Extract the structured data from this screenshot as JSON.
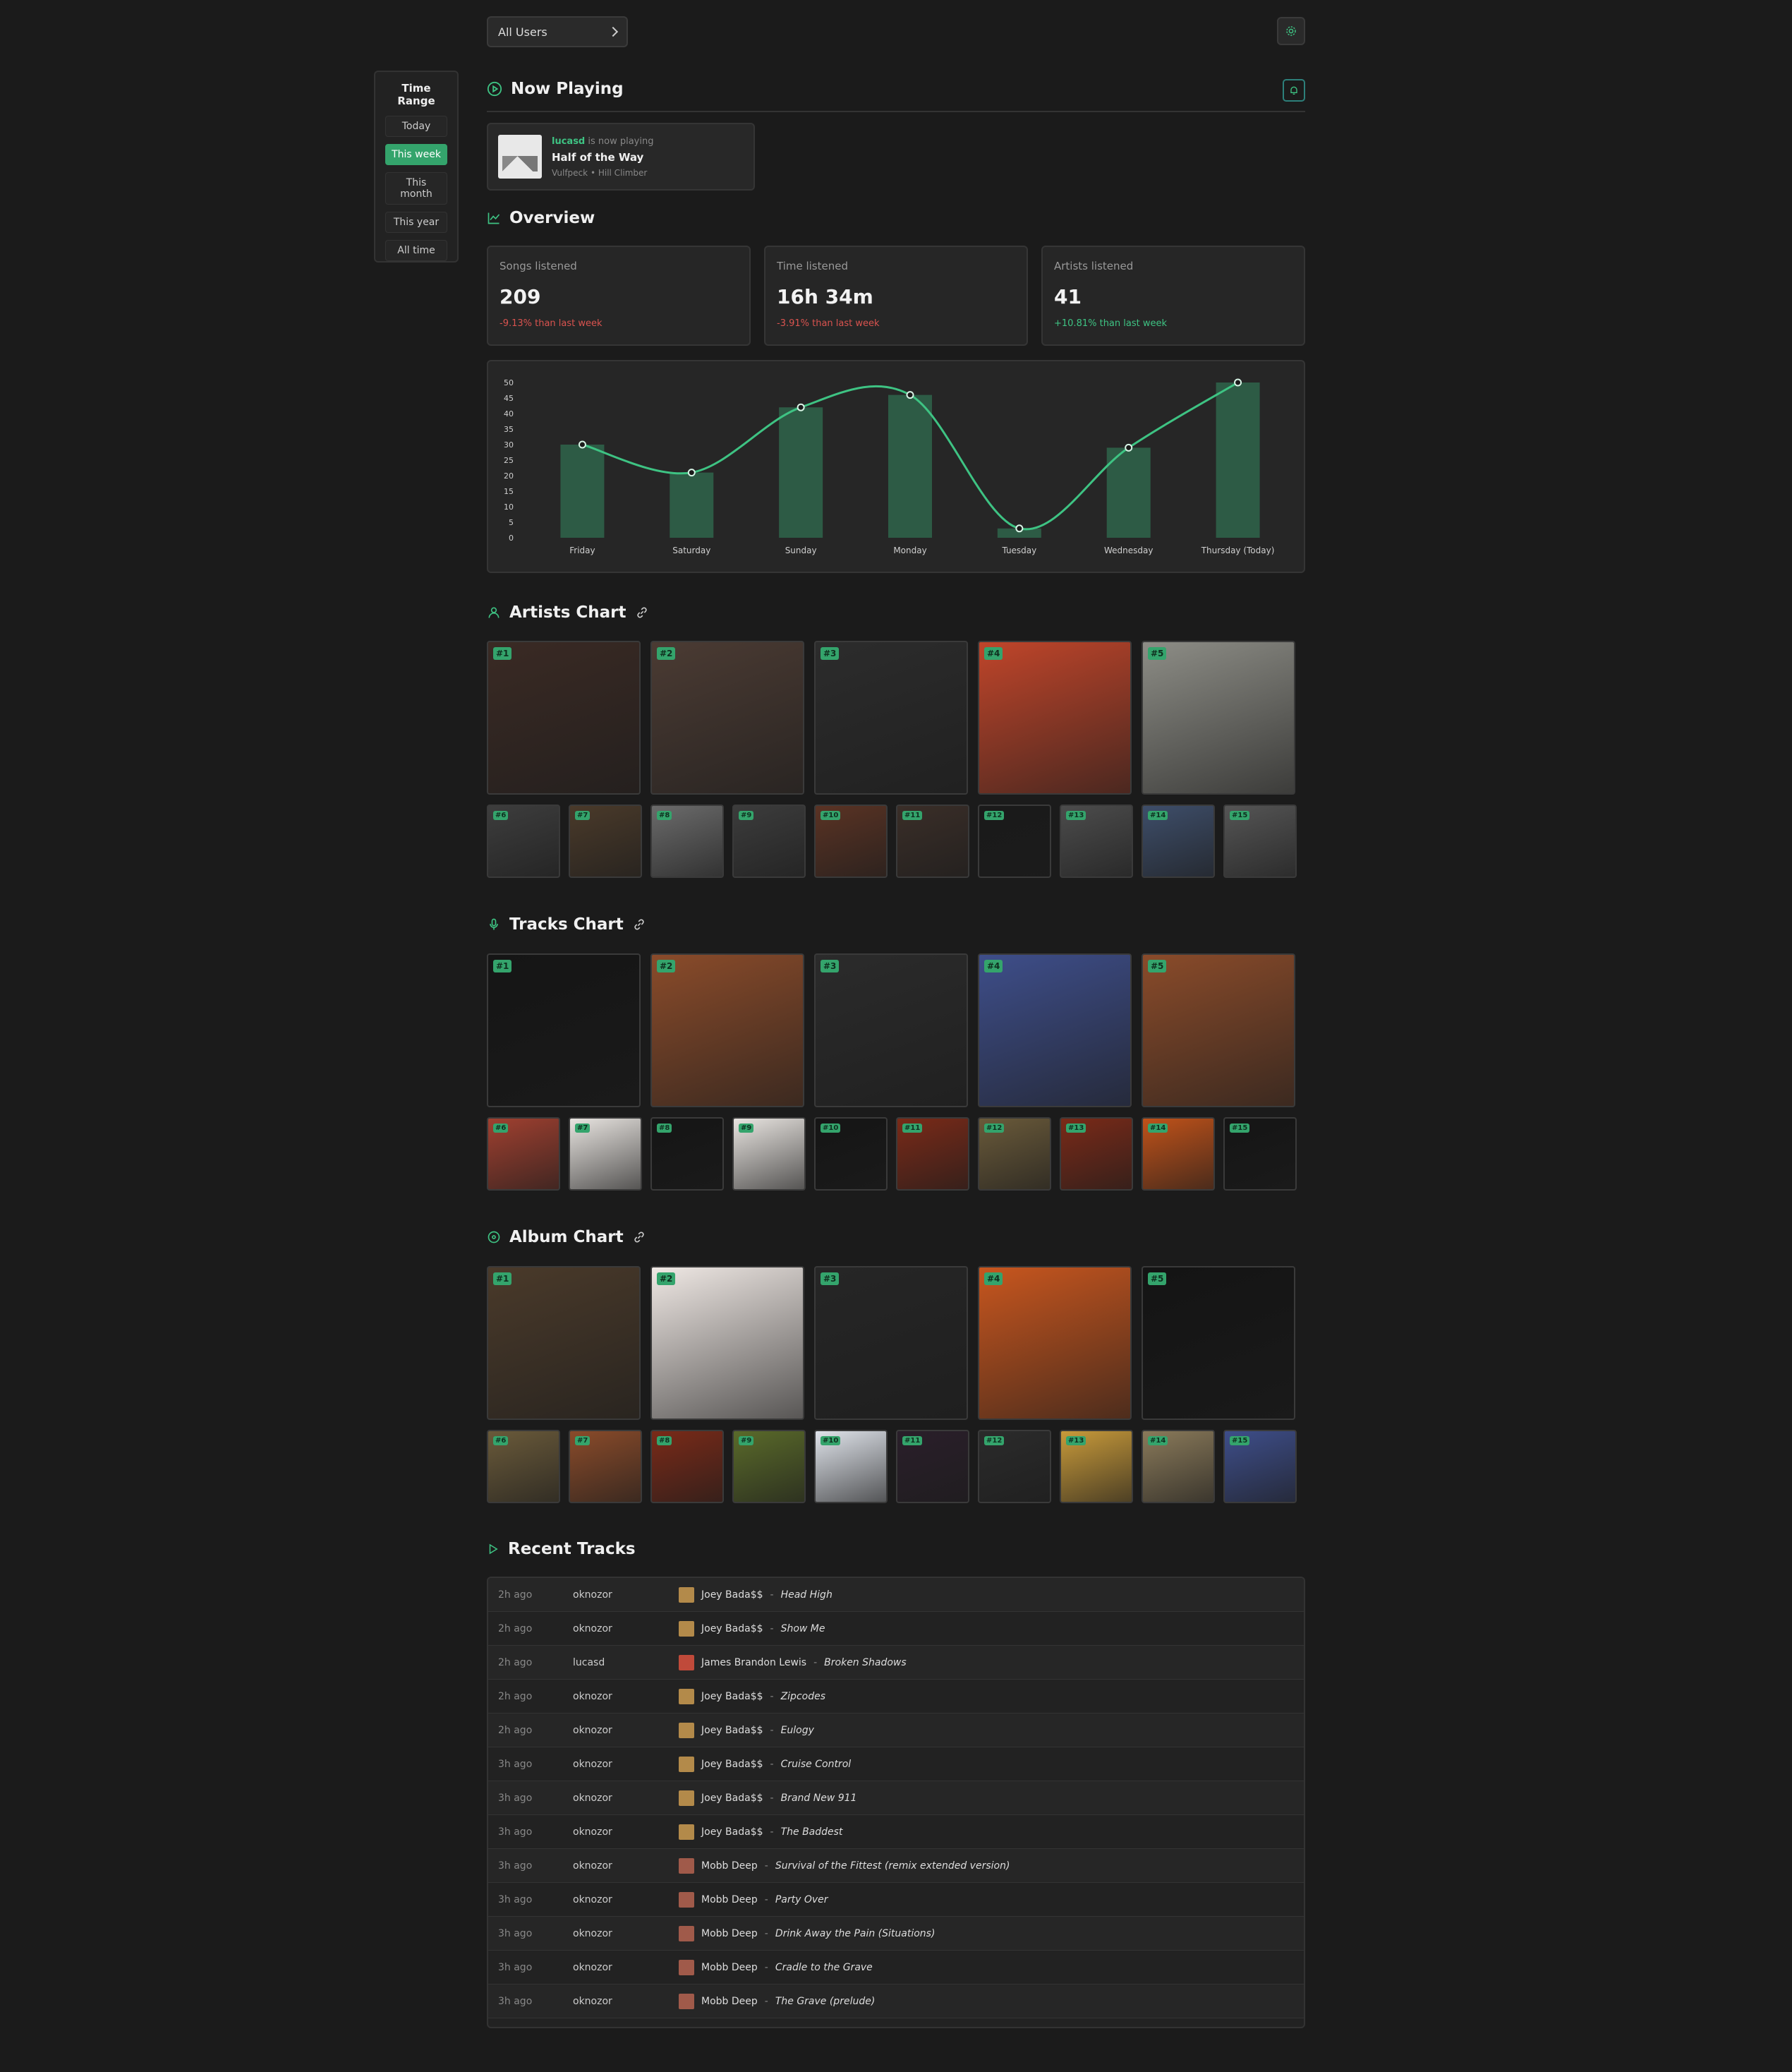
{
  "header": {
    "user_select": "All Users"
  },
  "sidebar": {
    "title": "Time Range",
    "ranges": [
      "Today",
      "This week",
      "This month",
      "This year",
      "All time"
    ],
    "active": "This week"
  },
  "now_playing": {
    "heading": "Now Playing",
    "user": "lucasd",
    "status": "is now playing",
    "title": "Half of the Way",
    "artist": "Vulfpeck",
    "album": "Hill Climber",
    "bullet": "•"
  },
  "overview": {
    "heading": "Overview",
    "stats": [
      {
        "label": "Songs listened",
        "value": "209",
        "delta": "-9.13% than last week",
        "trend": "neg"
      },
      {
        "label": "Time listened",
        "value": "16h 34m",
        "delta": "-3.91% than last week",
        "trend": "neg"
      },
      {
        "label": "Artists listened",
        "value": "41",
        "delta": "+10.81% than last week",
        "trend": "pos"
      }
    ]
  },
  "chart_data": {
    "type": "bar",
    "categories": [
      "Friday",
      "Saturday",
      "Sunday",
      "Monday",
      "Tuesday",
      "Wednesday",
      "Thursday  (Today)"
    ],
    "values": [
      30,
      21,
      42,
      46,
      3,
      29,
      50
    ],
    "y_ticks": [
      "0",
      "5",
      "10",
      "15",
      "20",
      "25",
      "30",
      "35",
      "40",
      "45",
      "50"
    ],
    "ylim": [
      0,
      50
    ],
    "bar_color": "#2d5b45",
    "line_color": "#3ec383"
  },
  "artists_chart": {
    "heading": "Artists Chart"
  },
  "tracks_chart": {
    "heading": "Tracks Chart"
  },
  "album_chart": {
    "heading": "Album Chart"
  },
  "ranks": [
    "#1",
    "#2",
    "#3",
    "#4",
    "#5",
    "#6",
    "#7",
    "#8",
    "#9",
    "#10",
    "#11",
    "#12",
    "#13",
    "#14",
    "#15"
  ],
  "recent_tracks": {
    "heading": "Recent Tracks",
    "dash": "-",
    "rows": [
      {
        "time": "2h ago",
        "user": "oknozor",
        "artist": "Joey Bada$$",
        "track": "Head High"
      },
      {
        "time": "2h ago",
        "user": "oknozor",
        "artist": "Joey Bada$$",
        "track": "Show Me"
      },
      {
        "time": "2h ago",
        "user": "lucasd",
        "artist": "James Brandon Lewis",
        "track": "Broken Shadows"
      },
      {
        "time": "2h ago",
        "user": "oknozor",
        "artist": "Joey Bada$$",
        "track": "Zipcodes"
      },
      {
        "time": "2h ago",
        "user": "oknozor",
        "artist": "Joey Bada$$",
        "track": "Eulogy"
      },
      {
        "time": "3h ago",
        "user": "oknozor",
        "artist": "Joey Bada$$",
        "track": "Cruise Control"
      },
      {
        "time": "3h ago",
        "user": "oknozor",
        "artist": "Joey Bada$$",
        "track": "Brand New 911"
      },
      {
        "time": "3h ago",
        "user": "oknozor",
        "artist": "Joey Bada$$",
        "track": "The Baddest"
      },
      {
        "time": "3h ago",
        "user": "oknozor",
        "artist": "Mobb Deep",
        "track": "Survival of the Fittest (remix extended version)"
      },
      {
        "time": "3h ago",
        "user": "oknozor",
        "artist": "Mobb Deep",
        "track": "Party Over"
      },
      {
        "time": "3h ago",
        "user": "oknozor",
        "artist": "Mobb Deep",
        "track": "Drink Away the Pain (Situations)"
      },
      {
        "time": "3h ago",
        "user": "oknozor",
        "artist": "Mobb Deep",
        "track": "Cradle to the Grave"
      },
      {
        "time": "3h ago",
        "user": "oknozor",
        "artist": "Mobb Deep",
        "track": "The Grave (prelude)"
      }
    ]
  }
}
